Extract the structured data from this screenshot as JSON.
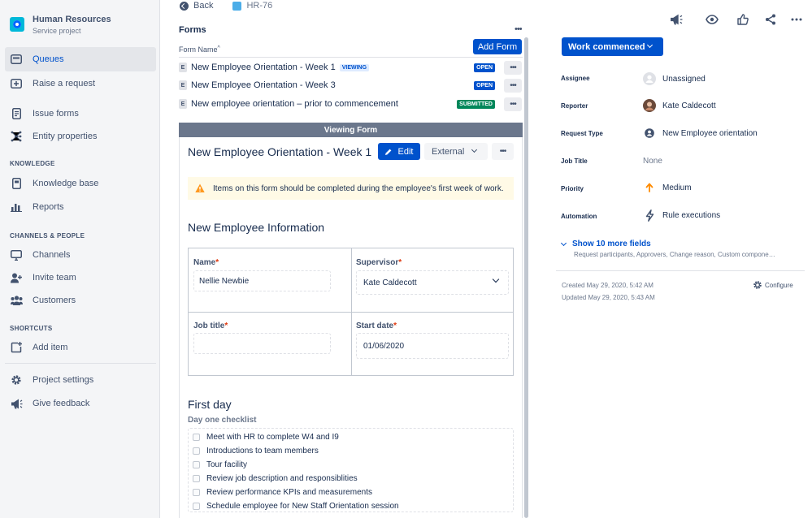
{
  "sidebar": {
    "project_name": "Human Resources",
    "project_type": "Service project",
    "items": [
      {
        "label": "Queues",
        "icon": "queues-icon"
      },
      {
        "label": "Raise a request",
        "icon": "raise-request-icon"
      },
      {
        "label": "Issue forms",
        "icon": "issue-forms-icon"
      },
      {
        "label": "Entity properties",
        "icon": "entity-properties-icon"
      },
      {
        "label": "Knowledge base",
        "icon": "knowledge-base-icon"
      },
      {
        "label": "Reports",
        "icon": "reports-icon"
      },
      {
        "label": "Channels",
        "icon": "channels-icon"
      },
      {
        "label": "Invite team",
        "icon": "invite-team-icon"
      },
      {
        "label": "Customers",
        "icon": "customers-icon"
      },
      {
        "label": "Add item",
        "icon": "add-item-icon"
      },
      {
        "label": "Project settings",
        "icon": "gear-icon"
      },
      {
        "label": "Give feedback",
        "icon": "megaphone-icon"
      }
    ],
    "sections": {
      "knowledge": "KNOWLEDGE",
      "channels": "CHANNELS & PEOPLE",
      "shortcuts": "SHORTCUTS"
    }
  },
  "breadcrumb": {
    "back": "Back",
    "issue_key": "HR-76"
  },
  "forms": {
    "title": "Forms",
    "more": "•••",
    "column_header": "Form Name",
    "sort_indicator": "^",
    "add_form_label": "Add Form",
    "rows": [
      {
        "badge": "E",
        "name": "New Employee Orientation - Week 1",
        "tag": "VIEWING",
        "status": "OPEN"
      },
      {
        "badge": "E",
        "name": "New Employee Orientation - Week 3",
        "tag": "",
        "status": "OPEN"
      },
      {
        "badge": "E",
        "name": "New employee orientation – prior to commencement",
        "tag": "",
        "status": "SUBMITTED"
      }
    ],
    "row_more": "•••"
  },
  "viewer": {
    "bar_label": "Viewing Form",
    "form_title": "New Employee Orientation - Week 1",
    "edit_label": "Edit",
    "visibility_label": "External",
    "more": "•••",
    "warning": "Items on this form should be completed during the employee's first week of work.",
    "section1_title": "New Employee Information",
    "fields": {
      "name_label": "Name",
      "name_value": "Nellie Newbie",
      "supervisor_label": "Supervisor",
      "supervisor_value": "Kate Caldecott",
      "job_title_label": "Job title",
      "job_title_value": "",
      "start_date_label": "Start date",
      "start_date_value": "01/06/2020",
      "required_mark": "*"
    },
    "section2_title": "First day",
    "checklist_label": "Day one checklist",
    "checklist": [
      "Meet with HR to complete W4 and I9",
      "Introductions to team members",
      "Tour facility",
      "Review job description and responsiblities",
      "Review performance KPIs and measurements",
      "Schedule employee for New Staff Orientation session"
    ]
  },
  "details": {
    "status_label": "Work commenced",
    "rows": [
      {
        "label": "Assignee",
        "value": "Unassigned",
        "icon": "unassigned-avatar-icon"
      },
      {
        "label": "Reporter",
        "value": "Kate Caldecott",
        "icon": "user-avatar"
      },
      {
        "label": "Request Type",
        "value": "New Employee orientation",
        "icon": "request-type-icon"
      },
      {
        "label": "Job Title",
        "value": "None",
        "icon": ""
      },
      {
        "label": "Priority",
        "value": "Medium",
        "icon": "priority-medium-icon"
      },
      {
        "label": "Automation",
        "value": "Rule executions",
        "icon": "lightning-icon"
      }
    ],
    "show_more_label": "Show 10 more fields",
    "show_more_sub": "Request participants, Approvers, Change reason, Custom compone…",
    "created": "Created May 29, 2020, 5:42 AM",
    "updated": "Updated May 29, 2020, 5:43 AM",
    "configure_label": "Configure"
  },
  "colors": {
    "brand": "#0052cc",
    "open_status": "#0052cc",
    "submitted_status": "#00875a",
    "warning_bg": "#fffae6",
    "priority_medium": "#ff8b00"
  }
}
